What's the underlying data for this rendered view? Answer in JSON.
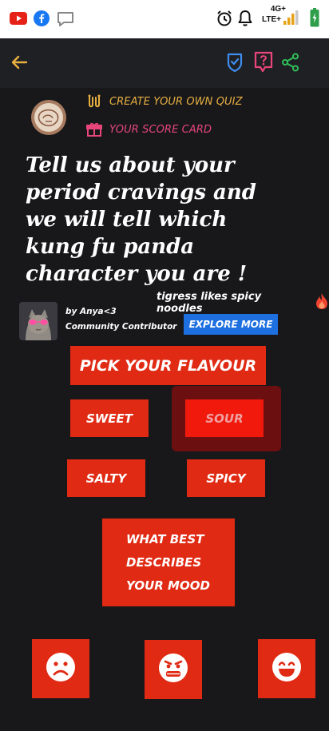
{
  "status_bar": {
    "network_top": "4G+",
    "network_bottom": "LTE+",
    "icons": [
      "youtube-icon",
      "facebook-icon",
      "message-icon",
      "alarm-icon",
      "bell-icon",
      "signal-icon",
      "battery-icon"
    ]
  },
  "app_bar": {
    "back_icon": "arrow-left-icon",
    "actions": [
      "shield-check-icon",
      "help-icon",
      "share-icon"
    ]
  },
  "header_links": {
    "create_quiz": "CREATE YOUR OWN QUIZ",
    "score_card": "YOUR SCORE CARD"
  },
  "quiz": {
    "title": "Tell us about your period cravings and we will tell which kung fu panda character you are !",
    "hint": "tigress likes spicy noodles",
    "author_name": "by Anya<3",
    "author_role": "Community Contributor",
    "explore_label": "EXPLORE MORE"
  },
  "question1": {
    "label": "PICK YOUR FLAVOUR",
    "options": [
      "SWEET",
      "SOUR",
      "SALTY",
      "SPICY"
    ],
    "selected": "SOUR"
  },
  "question2": {
    "label_lines": [
      "WHAT BEST",
      "DESCRIBES",
      "YOUR MOOD"
    ],
    "options": [
      "sad-face-icon",
      "angry-face-icon",
      "happy-face-icon"
    ]
  },
  "colors": {
    "accent_red": "#e02a14",
    "selected_highlight": "#6b0f10",
    "explore_blue": "#1e6fe0",
    "gold": "#e8b040",
    "pink": "#e8457a",
    "background": "#18181b"
  }
}
